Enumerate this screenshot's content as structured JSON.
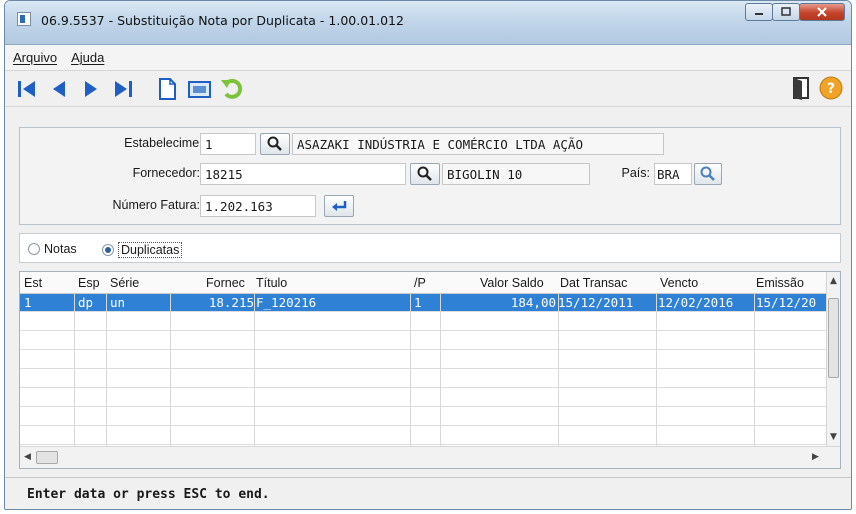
{
  "window": {
    "title": "06.9.5537 - Substituição Nota por Duplicata - 1.00.01.012"
  },
  "menu": {
    "items": [
      "Arquivo",
      "Ajuda"
    ]
  },
  "toolbar": {
    "icons": [
      "first-record-icon",
      "previous-record-icon",
      "next-record-icon",
      "last-record-icon",
      "new-document-icon",
      "preview-icon",
      "undo-icon",
      "exit-door-icon",
      "help-icon"
    ],
    "accent_color": "#1f5fc4"
  },
  "form": {
    "estabelecimento": {
      "label": "Estabelecimento:",
      "code": "1",
      "name": "ASAZAKI INDÚSTRIA E COMÉRCIO LTDA AÇÃO"
    },
    "fornecedor": {
      "label": "Fornecedor:",
      "code": "18215",
      "name": "BIGOLIN 10"
    },
    "pais": {
      "label": "País:",
      "value": "BRA"
    },
    "numero_fatura": {
      "label": "Número Fatura:",
      "value": "1.202.163"
    }
  },
  "view_mode": {
    "options": [
      "Notas",
      "Duplicatas"
    ],
    "selected": "Duplicatas"
  },
  "table": {
    "headers": [
      "Est",
      "Esp",
      "Série",
      "Fornec",
      "Título",
      "/P",
      "Valor Saldo",
      "Dat Transac",
      "Vencto",
      "Emissão"
    ],
    "rows": [
      [
        "1",
        "dp",
        "un",
        "18.215",
        "F_120216",
        "1",
        "184,00",
        "15/12/2011",
        "12/02/2016",
        "15/12/20"
      ]
    ],
    "selected_row_color": "#2f81d6"
  },
  "status": {
    "text": "Enter data or press ESC to end."
  }
}
